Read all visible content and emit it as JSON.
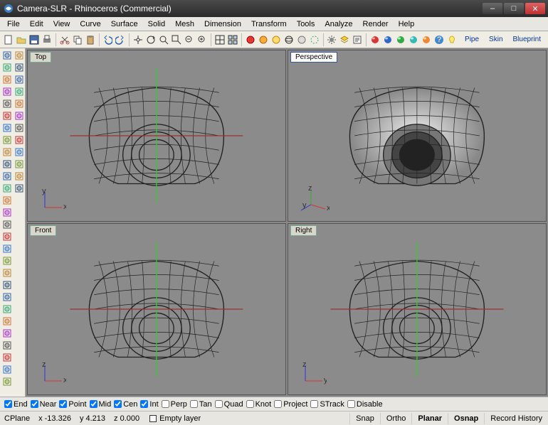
{
  "window": {
    "title": "Camera-SLR - Rhinoceros (Commercial)"
  },
  "menu": [
    "File",
    "Edit",
    "View",
    "Curve",
    "Surface",
    "Solid",
    "Mesh",
    "Dimension",
    "Transform",
    "Tools",
    "Analyze",
    "Render",
    "Help"
  ],
  "toolbar_links": [
    "Pipe",
    "Skin",
    "Blueprint"
  ],
  "toolbar_icons": [
    "new",
    "open",
    "save",
    "print",
    "sep",
    "cut",
    "copy",
    "paste",
    "sep",
    "undo",
    "redo",
    "sep",
    "pan",
    "rotate-view",
    "zoom-extents",
    "zoom-window",
    "zoom-previous",
    "zoom-selected",
    "sep",
    "set-view",
    "four-view",
    "sep",
    "shade",
    "render",
    "render-preview",
    "wireframe",
    "ghosted",
    "xray",
    "sep",
    "options",
    "layers",
    "properties",
    "sep",
    "sphere-red",
    "sphere-blue",
    "sphere-green",
    "sphere-cyan",
    "sphere-orange",
    "help",
    "tip"
  ],
  "side_icons": [
    "pointer",
    "lasso",
    "window-select",
    "circle-select",
    "line",
    "polyline",
    "curve",
    "arc",
    "rectangle",
    "circle",
    "ellipse",
    "polygon",
    "text",
    "dimension",
    "point",
    "pointcloud",
    "box",
    "sphere",
    "cylinder",
    "cone",
    "torus",
    "tube",
    "pipe",
    "extrude",
    "revolve",
    "sweep",
    "loft",
    "blend",
    "join",
    "trim",
    "split",
    "fillet",
    "chamfer",
    "offset",
    "mirror",
    "rotate",
    "scale",
    "array",
    "move",
    "copy-obj"
  ],
  "viewports": [
    {
      "label": "Top",
      "active": false,
      "axes": [
        "x",
        "y"
      ]
    },
    {
      "label": "Perspective",
      "active": true,
      "axes": [
        "x",
        "y",
        "z"
      ]
    },
    {
      "label": "Front",
      "active": false,
      "axes": [
        "x",
        "z"
      ]
    },
    {
      "label": "Right",
      "active": false,
      "axes": [
        "y",
        "z"
      ]
    }
  ],
  "osnaps": [
    {
      "label": "End",
      "checked": true
    },
    {
      "label": "Near",
      "checked": true
    },
    {
      "label": "Point",
      "checked": true
    },
    {
      "label": "Mid",
      "checked": true
    },
    {
      "label": "Cen",
      "checked": true
    },
    {
      "label": "Int",
      "checked": true
    },
    {
      "label": "Perp",
      "checked": false
    },
    {
      "label": "Tan",
      "checked": false
    },
    {
      "label": "Quad",
      "checked": false
    },
    {
      "label": "Knot",
      "checked": false
    },
    {
      "label": "Project",
      "checked": false
    },
    {
      "label": "STrack",
      "checked": false
    },
    {
      "label": "Disable",
      "checked": false
    }
  ],
  "status": {
    "cplane": "CPlane",
    "x": "x -13.326",
    "y": "y 4.213",
    "z": "z 0.000",
    "layer_label": "Empty layer",
    "toggles": [
      "Snap",
      "Ortho",
      "Planar",
      "Osnap",
      "Record History"
    ],
    "bold_toggles": [
      "Planar",
      "Osnap"
    ]
  }
}
